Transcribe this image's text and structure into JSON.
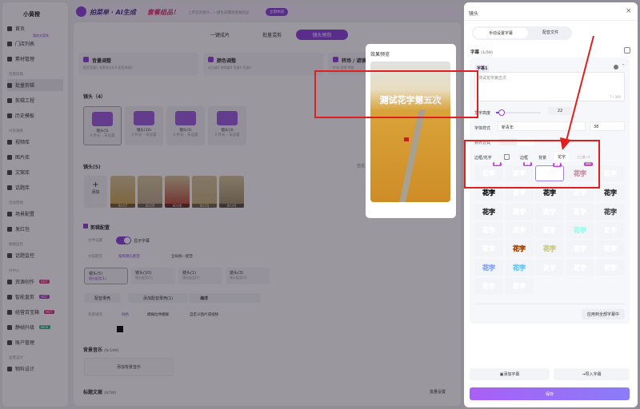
{
  "sidebar": {
    "logo": "小黄橙",
    "top_badge": "我的文案库",
    "items": [
      {
        "label": "首页"
      },
      {
        "label": "门店列表"
      },
      {
        "label": "素材管理"
      },
      {
        "section": "批量剪辑"
      },
      {
        "label": "批量剪辑",
        "active": true
      },
      {
        "label": "剪辑工程"
      },
      {
        "label": "历史模板"
      },
      {
        "section": "AI资源库"
      },
      {
        "label": "视频库"
      },
      {
        "label": "图片库"
      },
      {
        "label": "文案库"
      },
      {
        "label": "话题库"
      },
      {
        "section": "活动营销"
      },
      {
        "label": "场景配置"
      },
      {
        "label": "发红包"
      },
      {
        "section": "数据监控"
      },
      {
        "label": "话题监控"
      },
      {
        "section": "AI中心"
      },
      {
        "label": "资源创作",
        "badge": "HOT",
        "badge_color": "#d0317a"
      },
      {
        "label": "智能直剪",
        "badge": "HOT",
        "badge_color": "#b02ad0"
      },
      {
        "label": "经营百宝箱",
        "badge": "HOT",
        "badge_color": "#d0317a"
      },
      {
        "label": "静帧升级",
        "badge": "NEW",
        "badge_color": "#2bb58a"
      },
      {
        "label": "账户管理"
      },
      {
        "section": "运营设计"
      },
      {
        "label": "物料设计"
      }
    ]
  },
  "banner": {
    "title": "拍菜单 · AI生成",
    "highlight": "套餐组品！",
    "sub": "上传菜单图片，一键生成爆款套餐组品",
    "button": "立即体验"
  },
  "mode_tabs": [
    {
      "label": "一键成片"
    },
    {
      "label": "批量混剪"
    },
    {
      "label": "镜头预剪",
      "active": true
    }
  ],
  "feature_cards": [
    {
      "title": "音量调整",
      "desc": "配音音量1 背景音乐0.6 配音调速1"
    },
    {
      "title": "颜色调整",
      "desc": "对比度0 饱和度0 亮度0 色度0"
    },
    {
      "title": "转场 / 滤镜",
      "desc": "转场 滤镜 特效"
    }
  ],
  "shots": {
    "title": "镜头（4）",
    "items": [
      {
        "name": "镜头(5)",
        "meta": "0 秒长 · 未设置"
      },
      {
        "name": "镜头(10)",
        "meta": "0 秒长 · 未设置"
      },
      {
        "name": "镜头(1)",
        "meta": "0 秒长 · 未设置"
      },
      {
        "name": "镜头(3)",
        "meta": "0 秒长 · 未设置"
      }
    ]
  },
  "clips": {
    "title": "镜头(5)",
    "add": "添加",
    "right_link": "自定义",
    "durations": [
      "00:07",
      "00:05",
      "00:06",
      "00:05",
      "00:05"
    ]
  },
  "edit_config": {
    "title": "剪辑配置",
    "full_setting": "文件设置",
    "show_subtitle": "显示字幕",
    "voice_label": "文案配音",
    "voice_opt1": "按照镜头配音",
    "voice_opt2": "全局统一配音",
    "shot_tabs": [
      {
        "name": "镜头(5)",
        "meta": "镜头配音(1)"
      },
      {
        "name": "镜头(10)",
        "meta": "镜头配音(1)"
      },
      {
        "name": "镜头(1)",
        "meta": "镜头配音(1)"
      },
      {
        "name": "镜头(3)",
        "meta": "镜头配音(0)"
      }
    ],
    "dub_btn": "配音果壳",
    "add_dub": "添加配音果壳(1)",
    "voice_name": "海洋",
    "bg_label": "背景填充",
    "bg_opt1": "纯色",
    "bg_opt2": "模糊拉伸模糊",
    "bg_opt3": "自定义图片或视频"
  },
  "music": {
    "title": "背景音乐",
    "count": "(0/100)",
    "add": "添加背景音乐"
  },
  "title_copy": {
    "title": "标题文案",
    "count": "(0/50)",
    "batch": "批量设置"
  },
  "preview": {
    "title": "效果预览",
    "caption": "测试花字第五次"
  },
  "panel": {
    "title": "镜头",
    "close": "×",
    "seg": [
      "手动设置字幕",
      "配音文件"
    ],
    "subtitle_label": "字幕",
    "subtitle_count": "(1/50)",
    "item_title": "字幕1",
    "text": "测试花字第五次",
    "char_count": "7 / 300",
    "height_label": "文字高度",
    "height_value": "22",
    "height_fraction": 0.1,
    "font_label": "字体样式",
    "font": "新青年",
    "size": "38",
    "align_label": "对齐方式",
    "style_tabs": [
      "边框/花字",
      "边框",
      "背景",
      "花字"
    ],
    "style_tab_hint": "(三选一)",
    "cell_text": "花字",
    "hot": "推荐",
    "styles": [
      {
        "c": "#7fd6f0",
        "s": "#fff",
        "hot": true
      },
      {
        "c": "#f08ad8",
        "s": "#fff",
        "hot": true
      },
      {
        "c": "#111",
        "s": "#fff",
        "hot": true,
        "sel": true
      },
      {
        "c": "#222",
        "s": "#c9a",
        "hot": true
      },
      {
        "c": "#6fd0e8",
        "s": "#fff"
      },
      {
        "c": "#fff",
        "s": "#111"
      },
      {
        "c": "#3ab0c8",
        "s": "#fff"
      },
      {
        "c": "#b8a030",
        "s": "#222"
      },
      {
        "c": "#5aa0f0",
        "s": "#fff"
      },
      {
        "c": "#ddd",
        "s": "#333"
      },
      {
        "c": "#fff",
        "s": "#333"
      },
      {
        "c": "#8cc8e0",
        "s": "#fff"
      },
      {
        "c": "#b880f0",
        "s": "#fff"
      },
      {
        "c": "#f07890",
        "s": "#fff"
      },
      {
        "c": "#b8d060",
        "s": "#555"
      },
      {
        "c": "#f080b8",
        "s": "#fff"
      },
      {
        "c": "#c09070",
        "s": "#fff"
      },
      {
        "c": "#f8a040",
        "s": "#fff"
      },
      {
        "c": "#40b890",
        "s": "#9fe"
      },
      {
        "c": "#111",
        "s": "#fff"
      },
      {
        "c": "#e85010",
        "s": "#fff"
      },
      {
        "c": "#f09030",
        "s": "#a40"
      },
      {
        "c": "#606020",
        "s": "#cc8"
      },
      {
        "c": "#c8a050",
        "s": "#fff"
      },
      {
        "c": "#aaa",
        "s": "#fff"
      },
      {
        "c": "#203080",
        "s": "#8af"
      },
      {
        "c": "#1a3a70",
        "s": "#6cf"
      },
      {
        "c": "#403090",
        "s": "#fff"
      },
      {
        "c": "#b03070",
        "s": "#fff"
      },
      {
        "c": "#f0a0b0",
        "s": "#fff"
      },
      {
        "c": "#6050b0",
        "s": "#fff"
      },
      {
        "c": "#40c0d8",
        "s": "#fff"
      }
    ],
    "apply_all": "应用到全部字幕中",
    "add_subtitle": "添加字幕",
    "import_subtitle": "导入字幕",
    "save": "保存"
  },
  "colors": {
    "accent": "#8b3fe0",
    "annotation": "#e02020"
  }
}
